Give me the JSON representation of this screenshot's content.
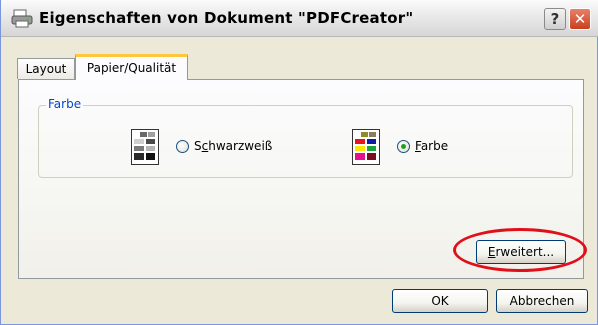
{
  "window": {
    "title": "Eigenschaften von Dokument \"PDFCreator\"",
    "title_icon": "printer-icon",
    "help_label": "?",
    "close_label": "✕"
  },
  "tabs": [
    {
      "label": "Layout",
      "active": false
    },
    {
      "label": "Papier/Qualität",
      "active": true
    }
  ],
  "color_group": {
    "legend": "Farbe",
    "options": [
      {
        "pre": "S",
        "underlined": "c",
        "post": "hwarzweiß",
        "checked": false,
        "icon": "grayscale-icon"
      },
      {
        "pre": "",
        "underlined": "F",
        "post": "arbe",
        "checked": true,
        "icon": "color-icon"
      }
    ]
  },
  "buttons": {
    "advanced_u": "E",
    "advanced_rest": "rweitert...",
    "ok": "OK",
    "cancel": "Abbrechen"
  },
  "colors": {
    "highlight": "#e0101a",
    "legend": "#0046d5"
  }
}
